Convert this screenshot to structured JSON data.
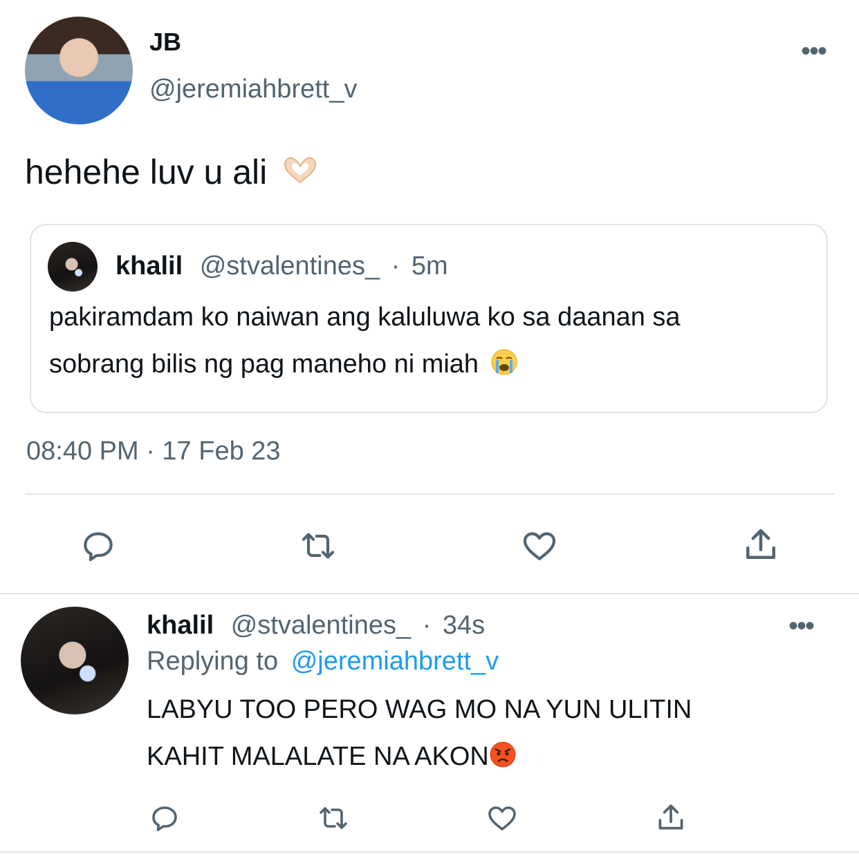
{
  "tweet": {
    "author_name": "JB",
    "author_handle": "@jeremiahbrett_v",
    "text": "hehehe luv u ali",
    "text_emoji": "heart-hands",
    "timestamp": "08:40 PM · 17 Feb 23",
    "quote": {
      "author_name": "khalil",
      "author_handle": "@stvalentines_",
      "separator": "·",
      "age": "5m",
      "line1": "pakiramdam ko naiwan ang kaluluwa ko sa daanan sa",
      "line2": "sobrang bilis ng pag maneho ni miah",
      "emoji": "loudly-crying-face"
    }
  },
  "reply": {
    "author_name": "khalil",
    "author_handle": "@stvalentines_",
    "separator": "·",
    "age": "34s",
    "replying_to_label": "Replying to",
    "replying_to_handle": "@jeremiahbrett_v",
    "line1": "LABYU TOO PERO WAG MO NA YUN ULITIN",
    "line2": "KAHIT MALALATE NA AKON",
    "emoji": "angry-face"
  },
  "more_glyph": "•••",
  "colors": {
    "text": "#0f1419",
    "muted": "#536471",
    "link": "#1d9bf0",
    "divider": "#e1e6ea"
  },
  "icons": [
    "reply-icon",
    "retweet-icon",
    "like-icon",
    "share-icon",
    "more-icon"
  ]
}
